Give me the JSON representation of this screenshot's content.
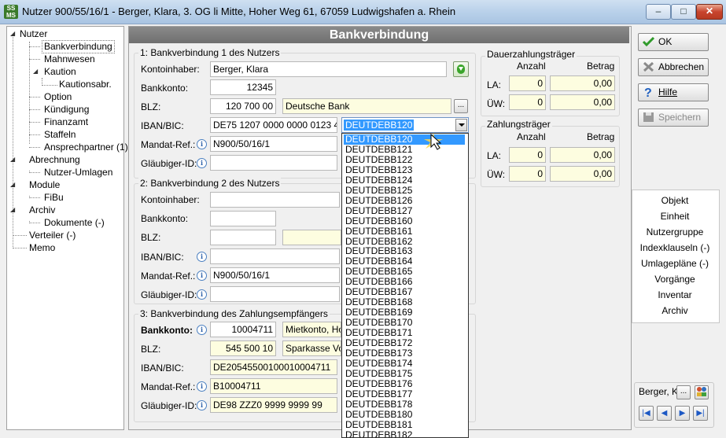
{
  "window": {
    "title": "Nutzer 900/55/16/1 - Berger, Klara, 3. OG li Mitte, Hoher Weg 61, 67059 Ludwigshafen a. Rhein",
    "icon_text": "SS\nMS"
  },
  "tree": {
    "items": [
      {
        "label": "Nutzer"
      },
      {
        "label": "Bankverbindung"
      },
      {
        "label": "Mahnwesen"
      },
      {
        "label": "Kaution"
      },
      {
        "label": "Kautionsabr."
      },
      {
        "label": "Option"
      },
      {
        "label": "Kündigung"
      },
      {
        "label": "Finanzamt"
      },
      {
        "label": "Staffeln"
      },
      {
        "label": "Ansprechpartner (1)"
      },
      {
        "label": "Abrechnung"
      },
      {
        "label": "Nutzer-Umlagen"
      },
      {
        "label": "Module"
      },
      {
        "label": "FiBu"
      },
      {
        "label": "Archiv"
      },
      {
        "label": "Dokumente (-)"
      },
      {
        "label": "Verteiler (-)"
      },
      {
        "label": "Memo"
      }
    ]
  },
  "header": {
    "title": "Bankverbindung"
  },
  "bank1": {
    "group_title": "1: Bankverbindung 1 des Nutzers",
    "kontoinhaber_label": "Kontoinhaber:",
    "kontoinhaber_value": "Berger, Klara",
    "bankkonto_label": "Bankkonto:",
    "bankkonto_value": "12345",
    "blz_label": "BLZ:",
    "blz_value": "120 700 00",
    "bank_name": "Deutsche Bank",
    "iban_label": "IBAN/BIC:",
    "iban_value": "DE75 1207 0000 0000 0123 45",
    "bic_selected": "DEUTDEBB120",
    "mandat_label": "Mandat-Ref.:",
    "mandat_value": "N900/50/16/1",
    "glaeubiger_label": "Gläubiger-ID:",
    "glaeubiger_value": ""
  },
  "bank2": {
    "group_title": "2: Bankverbindung 2 des Nutzers",
    "kontoinhaber_label": "Kontoinhaber:",
    "bankkonto_label": "Bankkonto:",
    "blz_label": "BLZ:",
    "iban_label": "IBAN/BIC:",
    "mandat_label": "Mandat-Ref.:",
    "mandat_value": "N900/50/16/1",
    "glaeubiger_label": "Gläubiger-ID:"
  },
  "bank3": {
    "group_title": "3: Bankverbindung des Zahlungsempfängers",
    "bankkonto_label": "Bankkonto:",
    "bankkonto_value": "10004711",
    "konto_desc": "Mietkonto,  Hoh",
    "blz_label": "BLZ:",
    "blz_value": "545 500 10",
    "bank_name": "Sparkasse Vord",
    "iban_label": "IBAN/BIC:",
    "iban_value": "DE20545500100010004711",
    "mandat_label": "Mandat-Ref.:",
    "mandat_value": "B10004711",
    "glaeubiger_label": "Gläubiger-ID:",
    "glaeubiger_value": "DE98 ZZZ0 9999 9999 99"
  },
  "bic_list": [
    "DEUTDEBB120",
    "DEUTDEBB121",
    "DEUTDEBB122",
    "DEUTDEBB123",
    "DEUTDEBB124",
    "DEUTDEBB125",
    "DEUTDEBB126",
    "DEUTDEBB127",
    "DEUTDEBB160",
    "DEUTDEBB161",
    "DEUTDEBB162",
    "DEUTDEBB163",
    "DEUTDEBB164",
    "DEUTDEBB165",
    "DEUTDEBB166",
    "DEUTDEBB167",
    "DEUTDEBB168",
    "DEUTDEBB169",
    "DEUTDEBB170",
    "DEUTDEBB171",
    "DEUTDEBB172",
    "DEUTDEBB173",
    "DEUTDEBB174",
    "DEUTDEBB175",
    "DEUTDEBB176",
    "DEUTDEBB177",
    "DEUTDEBB178",
    "DEUTDEBB180",
    "DEUTDEBB181",
    "DEUTDEBB182"
  ],
  "dauer": {
    "title": "Dauerzahlungsträger",
    "col_anzahl": "Anzahl",
    "col_betrag": "Betrag",
    "la_label": "LA:",
    "la_anzahl": "0",
    "la_betrag": "0,00",
    "uw_label": "ÜW:",
    "uw_anzahl": "0",
    "uw_betrag": "0,00"
  },
  "zahl": {
    "title": "Zahlungsträger",
    "col_anzahl": "Anzahl",
    "col_betrag": "Betrag",
    "la_label": "LA:",
    "la_anzahl": "0",
    "la_betrag": "0,00",
    "uw_label": "ÜW:",
    "uw_anzahl": "0",
    "uw_betrag": "0,00"
  },
  "buttons": {
    "ok": "OK",
    "abbrechen": "Abbrechen",
    "hilfe": "Hilfe",
    "speichern": "Speichern"
  },
  "links": [
    "Objekt",
    "Einheit",
    "Nutzergruppe",
    "Indexklauseln (-)",
    "Umlagepläne (-)",
    "Vorgänge",
    "Inventar",
    "Archiv"
  ],
  "nav": {
    "name": "Berger, K",
    "more": "..."
  },
  "colors": {
    "header_bg": "#7a7a7a",
    "highlight": "#3399ff",
    "yellow_field": "#fdfde0"
  }
}
